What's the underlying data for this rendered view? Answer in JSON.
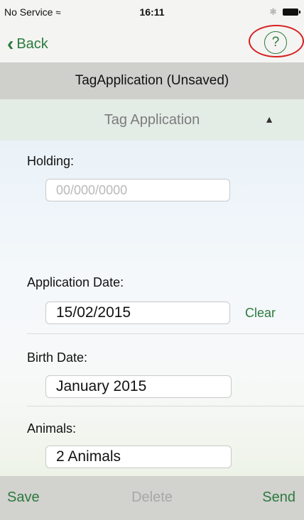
{
  "status": {
    "carrier": "No Service",
    "time": "16:11"
  },
  "nav": {
    "back_label": "Back",
    "help_label": "?"
  },
  "title": "TagApplication (Unsaved)",
  "section": {
    "title": "Tag Application",
    "chevron": "^"
  },
  "holding": {
    "label": "Holding:",
    "placeholder": "00/000/0000"
  },
  "application_date": {
    "label": "Application Date:",
    "value": "15/02/2015",
    "clear_label": "Clear"
  },
  "birth_date": {
    "label": "Birth Date:",
    "value": "January 2015"
  },
  "animals": {
    "label": "Animals:",
    "value": "2 Animals"
  },
  "toolbar": {
    "save_label": "Save",
    "delete_label": "Delete",
    "send_label": "Send"
  },
  "colors": {
    "accent": "#2c7a3d",
    "highlight_ring": "#d62020"
  }
}
